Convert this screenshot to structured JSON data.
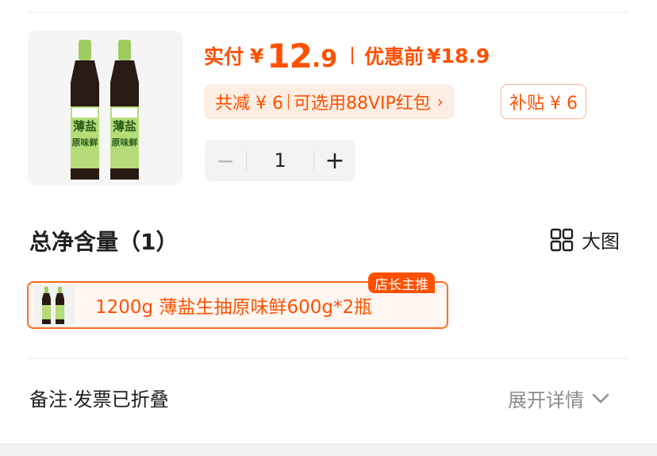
{
  "product": {
    "price_label": "实付",
    "currency": "¥",
    "price_int": "12",
    "price_dec": ".9",
    "orig_label": "优惠前",
    "orig_price": "¥18.9",
    "discount_total": "共减 ¥ 6",
    "discount_link": "可选用88VIP红包",
    "discount_chevron": "›",
    "subsidy": "补贴 ¥ 6",
    "quantity": "1",
    "minus": "−",
    "plus": "+",
    "bottle_text_1": "薄盐",
    "bottle_text_2": "原味鲜"
  },
  "spec": {
    "title": "总净含量（1）",
    "view_label": "大图",
    "option_label": "1200g 薄盐生抽原味鲜600g*2瓶",
    "option_badge": "店长主推"
  },
  "remarks": {
    "label": "备注·发票已折叠",
    "expand_label": "展开详情"
  },
  "colors": {
    "accent": "#ff5000",
    "bottle_dark": "#2a1a14",
    "label_green": "#a6d36a"
  }
}
